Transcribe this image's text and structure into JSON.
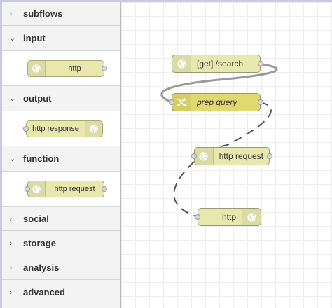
{
  "palette": {
    "categories": [
      {
        "label": "subflows",
        "state": "collapsed",
        "chevron": "›"
      },
      {
        "label": "input",
        "state": "expanded",
        "chevron": "⌄",
        "nodes": [
          {
            "label": "http",
            "icon": "globe-icon"
          }
        ]
      },
      {
        "label": "output",
        "state": "expanded",
        "chevron": "⌄",
        "nodes": [
          {
            "label": "http response",
            "icon": "globe-icon"
          }
        ]
      },
      {
        "label": "function",
        "state": "expanded",
        "chevron": "⌄",
        "nodes": [
          {
            "label": "http request",
            "icon": "globe-icon"
          }
        ]
      },
      {
        "label": "social",
        "state": "collapsed",
        "chevron": "›"
      },
      {
        "label": "storage",
        "state": "collapsed",
        "chevron": "›"
      },
      {
        "label": "analysis",
        "state": "collapsed",
        "chevron": "›"
      },
      {
        "label": "advanced",
        "state": "collapsed",
        "chevron": "›"
      }
    ]
  },
  "workspace": {
    "nodes": [
      {
        "id": "n1",
        "label": "[get] /search",
        "type": "http in",
        "icon": "globe-icon"
      },
      {
        "id": "n2",
        "label": "prep query",
        "type": "change",
        "icon": "shuffle-icon"
      },
      {
        "id": "n3",
        "label": "http request",
        "type": "http request",
        "icon": "globe-icon"
      },
      {
        "id": "n4",
        "label": "http",
        "type": "http response",
        "icon": "globe-icon"
      }
    ],
    "wires": [
      {
        "from": "n1",
        "to": "n2"
      },
      {
        "from": "n2",
        "to": "n3"
      },
      {
        "from": "n3",
        "to": "n4"
      }
    ]
  },
  "colors": {
    "node_http": "#e7e7ae",
    "node_function": "#e2d96e",
    "wire": "#999999",
    "wire_selected": "#555555",
    "palette_bg": "#f3f3f3"
  }
}
